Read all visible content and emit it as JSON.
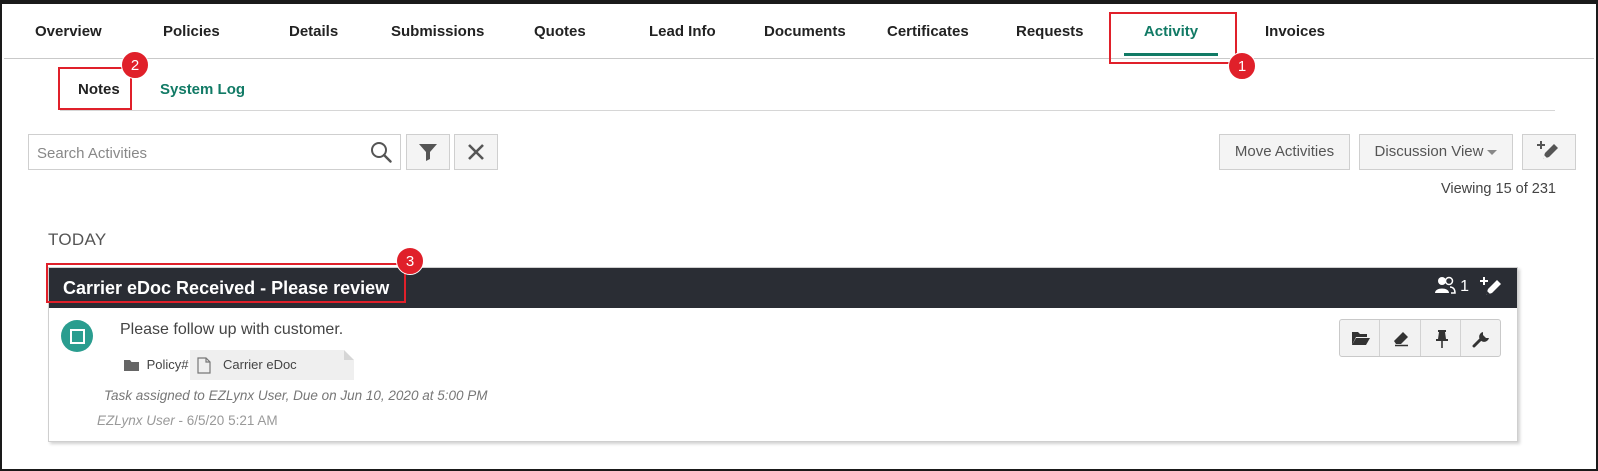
{
  "main_tabs": [
    {
      "label": "Overview"
    },
    {
      "label": "Policies"
    },
    {
      "label": "Details"
    },
    {
      "label": "Submissions"
    },
    {
      "label": "Quotes"
    },
    {
      "label": "Lead Info"
    },
    {
      "label": "Documents"
    },
    {
      "label": "Certificates"
    },
    {
      "label": "Requests"
    },
    {
      "label": "Activity",
      "active": true
    },
    {
      "label": "Invoices"
    }
  ],
  "sub_tabs": [
    {
      "label": "Notes",
      "active": true
    },
    {
      "label": "System Log"
    }
  ],
  "toolbar": {
    "search_placeholder": "Search Activities",
    "move_activities_label": "Move Activities",
    "discussion_view_label": "Discussion View",
    "viewing_text": "Viewing 15 of 231"
  },
  "section": {
    "label": "TODAY"
  },
  "activity": {
    "title": "Carrier eDoc Received - Please review",
    "participant_count": "1",
    "note": "Please follow up with customer.",
    "policy_label": "Policy#",
    "attachment_label": "Carrier eDoc",
    "task_line": "Task assigned to EZLynx User, Due on Jun 10, 2020 at 5:00 PM",
    "author": "EZLynx User",
    "timestamp": " - 6/5/20 5:21 AM"
  },
  "callouts": [
    "1",
    "2",
    "3"
  ],
  "colors": {
    "accent": "#117a65",
    "header_bg": "#2a2d34",
    "status_teal": "#2a9d8f",
    "callout_red": "#e0202a"
  }
}
